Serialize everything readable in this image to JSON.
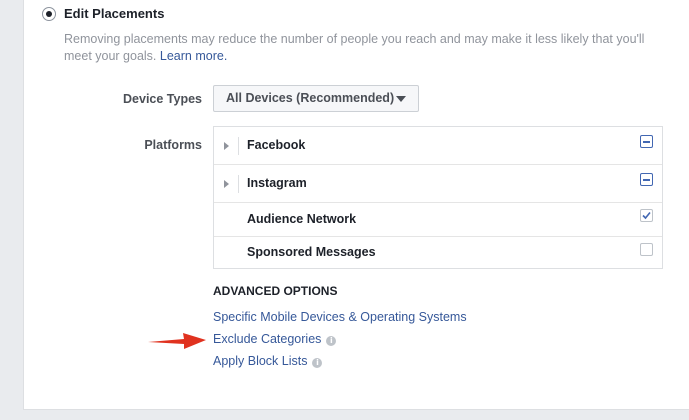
{
  "placement": {
    "option_label": "Edit Placements",
    "description": "Removing placements may reduce the number of people you reach and may make it less likely that you'll meet your goals.",
    "learn_more": "Learn more."
  },
  "device_types": {
    "label": "Device Types",
    "selected": "All Devices (Recommended)"
  },
  "platforms": {
    "label": "Platforms",
    "rows": [
      {
        "label": "Facebook",
        "expandable": true,
        "state": "indeterminate"
      },
      {
        "label": "Instagram",
        "expandable": true,
        "state": "indeterminate"
      },
      {
        "label": "Audience Network",
        "expandable": false,
        "state": "checked"
      },
      {
        "label": "Sponsored Messages",
        "expandable": false,
        "state": "unchecked"
      }
    ]
  },
  "advanced": {
    "heading": "ADVANCED OPTIONS",
    "links": [
      {
        "label": "Specific Mobile Devices & Operating Systems",
        "info": false
      },
      {
        "label": "Exclude Categories",
        "info": true
      },
      {
        "label": "Apply Block Lists",
        "info": true
      }
    ]
  },
  "icons": {
    "info_glyph": "i",
    "annotation_arrow_color": "#e0321f"
  },
  "colors": {
    "link": "#365899",
    "checkbox_accent": "#4267b2"
  }
}
